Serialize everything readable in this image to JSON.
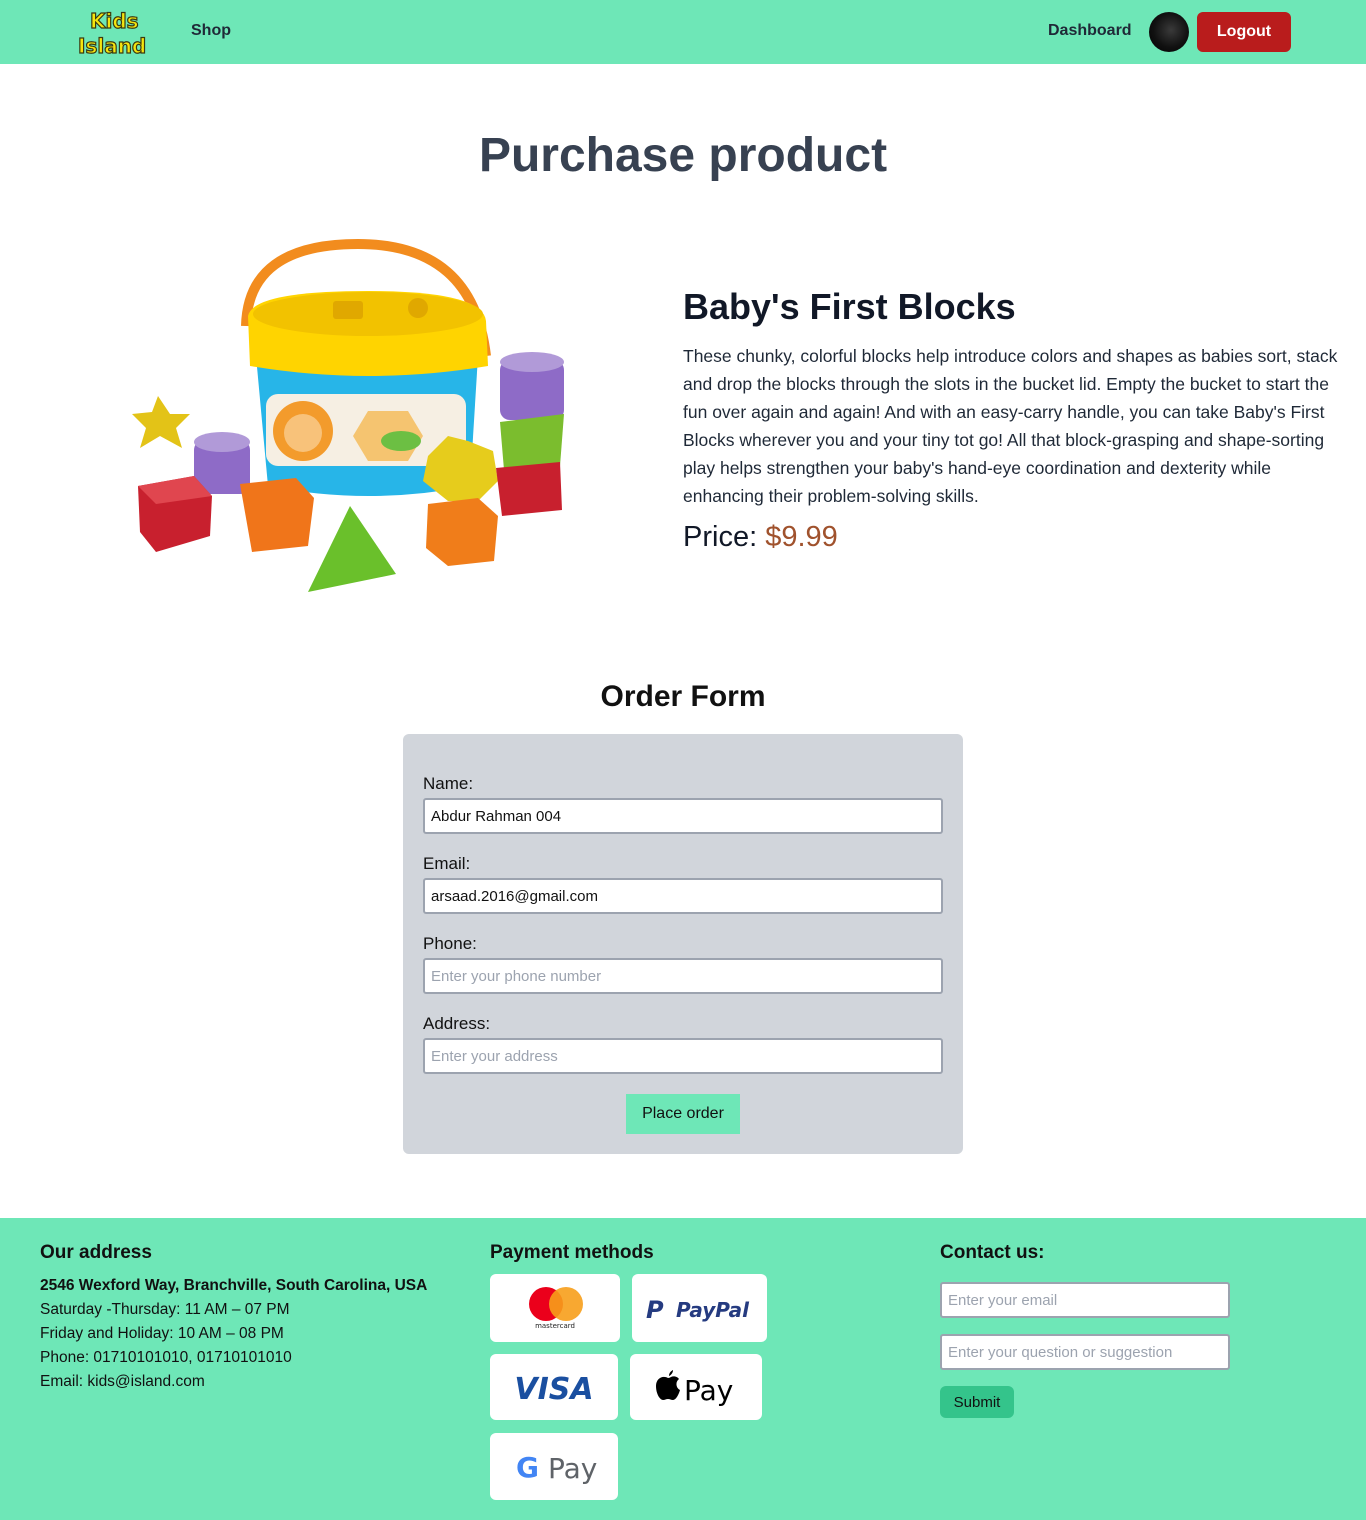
{
  "navbar": {
    "logo_line1": "Kids",
    "logo_line2": "Island",
    "shop_label": "Shop",
    "dashboard_label": "Dashboard",
    "logout_label": "Logout",
    "accent_color": "#6ee7b7",
    "logout_color": "#b91c1c"
  },
  "page_title": "Purchase product",
  "product": {
    "name": "Baby's First Blocks",
    "description": "These chunky, colorful blocks help introduce colors and shapes as babies sort, stack and drop the blocks through the slots in the bucket lid. Empty the bucket to start the fun over again and again! And with an easy-carry handle, you can take Baby's First Blocks wherever you and your tiny tot go! All that block-grasping and shape-sorting play helps strengthen your baby's hand-eye coordination and dexterity while enhancing their problem-solving skills.",
    "price_label": "Price:",
    "price_value": "$9.99"
  },
  "order_form": {
    "title": "Order Form",
    "name_label": "Name:",
    "name_value": "Abdur Rahman 004",
    "email_label": "Email:",
    "email_value": "arsaad.2016@gmail.com",
    "phone_label": "Phone:",
    "phone_placeholder": "Enter your phone number",
    "address_label": "Address:",
    "address_placeholder": "Enter your address",
    "submit_label": "Place order"
  },
  "footer": {
    "address_title": "Our address",
    "address_lines": [
      "2546 Wexford Way, Branchville, South Carolina, USA",
      "Saturday -Thursday: 11 AM – 07 PM",
      "Friday and Holiday: 10 AM – 08 PM",
      "Phone: 01710101010, 01710101010",
      "Email: kids@island.com"
    ],
    "payment_title": "Payment methods",
    "payment_methods": [
      "mastercard",
      "PayPal",
      "VISA",
      "Pay",
      "Pay"
    ],
    "contact_title": "Contact us:",
    "contact_email_placeholder": "Enter your email",
    "contact_question_placeholder": "Enter your question or suggestion",
    "submit_label": "Submit"
  }
}
